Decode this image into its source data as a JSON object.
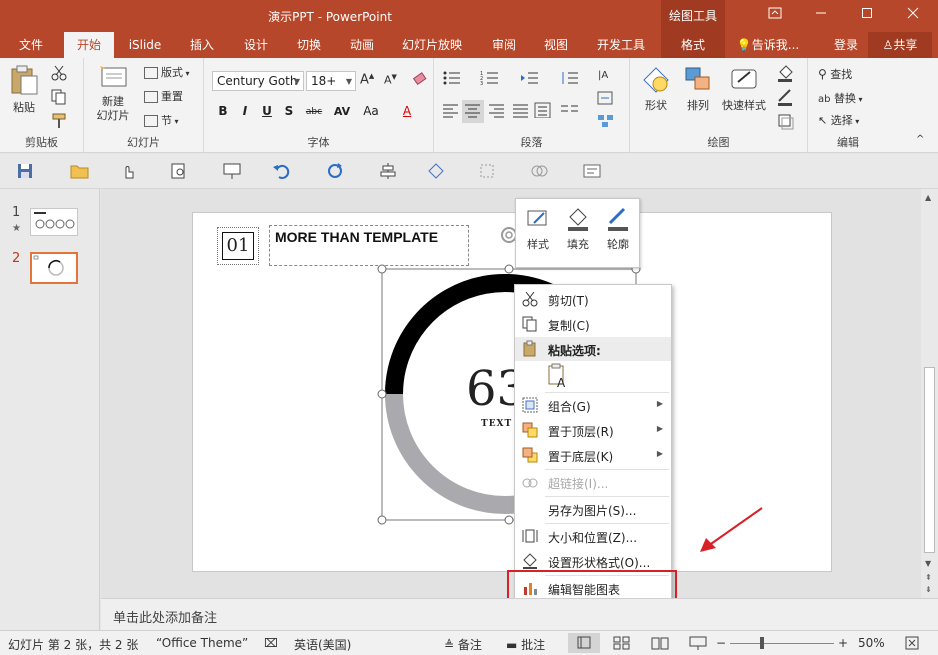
{
  "app": {
    "window_title": "演示PPT - PowerPoint",
    "contextual_tab_group": "绘图工具"
  },
  "tabs": [
    {
      "label": "文件"
    },
    {
      "label": "开始"
    },
    {
      "label": "iSlide"
    },
    {
      "label": "插入"
    },
    {
      "label": "设计"
    },
    {
      "label": "切换"
    },
    {
      "label": "动画"
    },
    {
      "label": "幻灯片放映"
    },
    {
      "label": "审阅"
    },
    {
      "label": "视图"
    },
    {
      "label": "开发工具"
    },
    {
      "label": "格式"
    }
  ],
  "tell_me": "告诉我...",
  "signin": "登录",
  "share": "共享",
  "ribbon": {
    "clipboard": {
      "paste": "粘贴",
      "group": "剪贴板"
    },
    "slides": {
      "new_slide": "新建\n幻灯片",
      "layout": "版式",
      "reset": "重置",
      "section": "节",
      "group": "幻灯片"
    },
    "font": {
      "font_name": "Century Goth",
      "font_size": "18+",
      "group": "字体"
    },
    "paragraph": {
      "group": "段落"
    },
    "drawing": {
      "shapes": "形状",
      "arrange": "排列",
      "quick_styles": "快速样式",
      "group": "绘图"
    },
    "editing": {
      "find": "查找",
      "replace": "替换",
      "select": "选择",
      "group": "编辑"
    }
  },
  "thumbnails": [
    {
      "number": "1"
    },
    {
      "number": "2"
    }
  ],
  "slide": {
    "number_box": "01",
    "heading": "MORE THAN TEMPLATE",
    "big_number": "63",
    "sub_text": "TEXT H",
    "ring_percent": 63
  },
  "mini_toolbar": {
    "style": "样式",
    "fill": "填充",
    "outline": "轮廓"
  },
  "context_menu": {
    "items": [
      {
        "label": "剪切(T)",
        "icon": "scissors-icon"
      },
      {
        "label": "复制(C)",
        "icon": "copy-icon"
      },
      {
        "label": "粘贴选项:",
        "icon": "paste-icon"
      },
      {
        "label": "组合(G)",
        "icon": "group-icon"
      },
      {
        "label": "置于顶层(R)",
        "icon": "bring-front-icon"
      },
      {
        "label": "置于底层(K)",
        "icon": "send-back-icon"
      },
      {
        "label": "超链接(I)...",
        "icon": "link-icon"
      },
      {
        "label": "另存为图片(S)...",
        "icon": ""
      },
      {
        "label": "大小和位置(Z)...",
        "icon": "size-icon"
      },
      {
        "label": "设置形状格式(O)...",
        "icon": "format-shape-icon"
      },
      {
        "label": "编辑智能图表",
        "icon": "chart-icon"
      }
    ]
  },
  "notes_placeholder": "单击此处添加备注",
  "status": {
    "slide_info": "幻灯片 第 2 张，共 2 张",
    "theme": "“Office Theme”",
    "language": "英语(美国)",
    "notes": "备注",
    "comments": "批注",
    "zoom": "50%"
  },
  "colors": {
    "accent": "#b7472a",
    "highlight": "#d92027"
  }
}
